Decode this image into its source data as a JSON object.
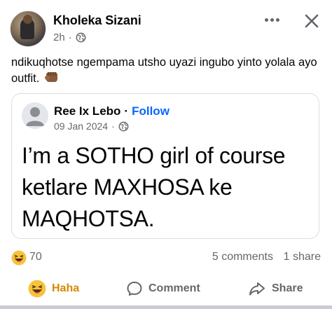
{
  "post": {
    "author": "Kholeka Sizani",
    "time": "2h",
    "separator": "·",
    "text": "ndikuqhotse ngempama utsho uyazi ingubo yinto yolala ayo outfit."
  },
  "shared": {
    "author": "Ree Ix Lebo",
    "separator": "·",
    "follow_label": "Follow",
    "date": "09 Jan 2024",
    "text": "I’m a SOTHO girl of course ketlare MAXHOSA ke MAQHOTSA."
  },
  "stats": {
    "reaction_count": "70",
    "comments": "5 comments",
    "shares": "1 share"
  },
  "actions": {
    "haha_label": "Haha",
    "comment_label": "Comment",
    "share_label": "Share"
  },
  "colors": {
    "link_blue": "#0866ff",
    "haha_orange": "#d48a00",
    "secondary_text": "#65676b"
  }
}
